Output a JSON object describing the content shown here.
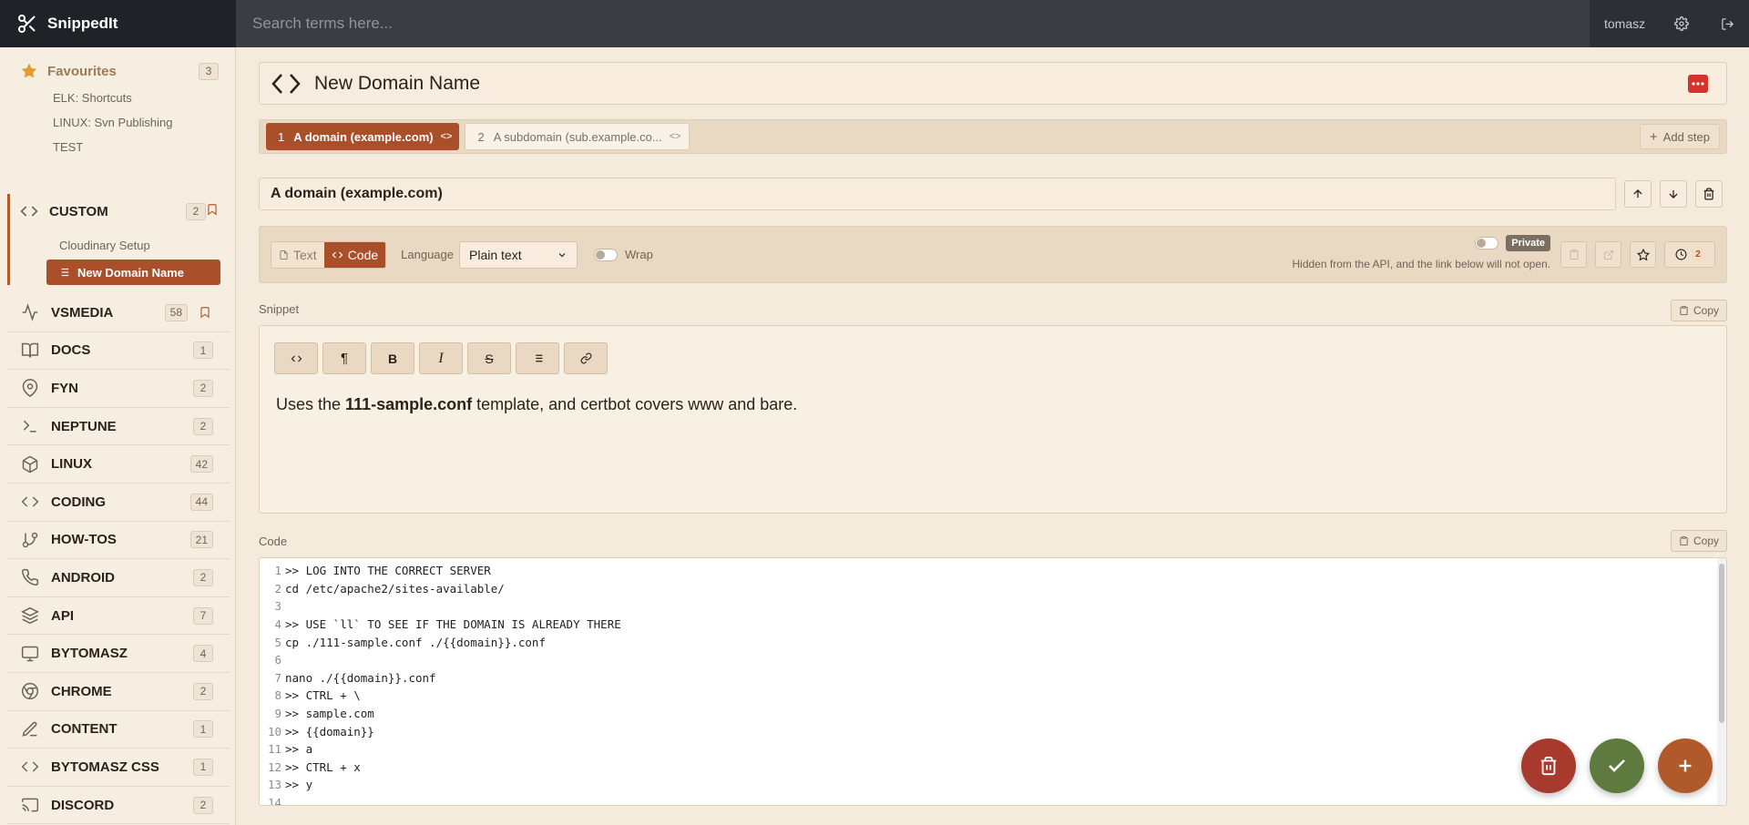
{
  "app": {
    "name": "SnippedIt"
  },
  "search": {
    "placeholder": "Search terms here..."
  },
  "user": {
    "name": "tomasz"
  },
  "sidebar": {
    "favourites": {
      "label": "Favourites",
      "count": "3",
      "items": [
        "ELK: Shortcuts",
        "LINUX: Svn Publishing",
        "TEST"
      ]
    },
    "custom": {
      "label": "CUSTOM",
      "count": "2",
      "items": [
        "Cloudinary Setup"
      ],
      "active_item": "New Domain Name"
    },
    "categories": [
      {
        "label": "VSMEDIA",
        "count": "58",
        "icon": "activity-icon",
        "bookmark": true
      },
      {
        "label": "DOCS",
        "count": "1",
        "icon": "book-icon"
      },
      {
        "label": "FYN",
        "count": "2",
        "icon": "map-pin-icon"
      },
      {
        "label": "NEPTUNE",
        "count": "2",
        "icon": "terminal-icon"
      },
      {
        "label": "LINUX",
        "count": "42",
        "icon": "box-icon"
      },
      {
        "label": "CODING",
        "count": "44",
        "icon": "code-icon"
      },
      {
        "label": "HOW-TOS",
        "count": "21",
        "icon": "git-branch-icon"
      },
      {
        "label": "ANDROID",
        "count": "2",
        "icon": "phone-icon"
      },
      {
        "label": "API",
        "count": "7",
        "icon": "layers-icon"
      },
      {
        "label": "BYTOMASZ",
        "count": "4",
        "icon": "monitor-icon"
      },
      {
        "label": "CHROME",
        "count": "2",
        "icon": "chrome-icon"
      },
      {
        "label": "CONTENT",
        "count": "1",
        "icon": "pen-icon"
      },
      {
        "label": "BYTOMASZ CSS",
        "count": "1",
        "icon": "code-icon"
      },
      {
        "label": "DISCORD",
        "count": "2",
        "icon": "cast-icon"
      }
    ]
  },
  "snippet": {
    "title": "New Domain Name",
    "steps": [
      {
        "number": "1",
        "label": "A domain (example.com)"
      },
      {
        "number": "2",
        "label": "A subdomain (sub.example.co..."
      }
    ],
    "add_step_label": "Add step",
    "step_title": "A domain (example.com)",
    "editor": {
      "text_label": "Text",
      "code_label": "Code",
      "language_label": "Language",
      "language_value": "Plain text",
      "wrap_label": "Wrap",
      "private_label": "Private",
      "private_note": "Hidden from the API, and the link below will not open.",
      "history_count": "2"
    },
    "snippet_label": "Snippet",
    "copy_label": "Copy",
    "snippet_text": {
      "before": "Uses the ",
      "bold": "111-sample.conf",
      "after": " template, and certbot covers www and bare."
    },
    "code_label": "Code",
    "code_lines": [
      ">> LOG INTO THE CORRECT SERVER",
      "cd /etc/apache2/sites-available/",
      "",
      ">> USE `ll` TO SEE IF THE DOMAIN IS ALREADY THERE",
      "cp ./111-sample.conf ./{{domain}}.conf",
      "",
      "nano ./{{domain}}.conf",
      ">> CTRL + \\",
      ">> sample.com",
      ">> {{domain}}",
      ">> a",
      ">> CTRL + x",
      ">> y",
      ""
    ]
  },
  "colors": {
    "accent": "#a9502a",
    "delete_fab": "#a73a2c",
    "save_fab": "#5f7a3e",
    "add_fab": "#b05a2c",
    "topbar": "#2c3034"
  }
}
